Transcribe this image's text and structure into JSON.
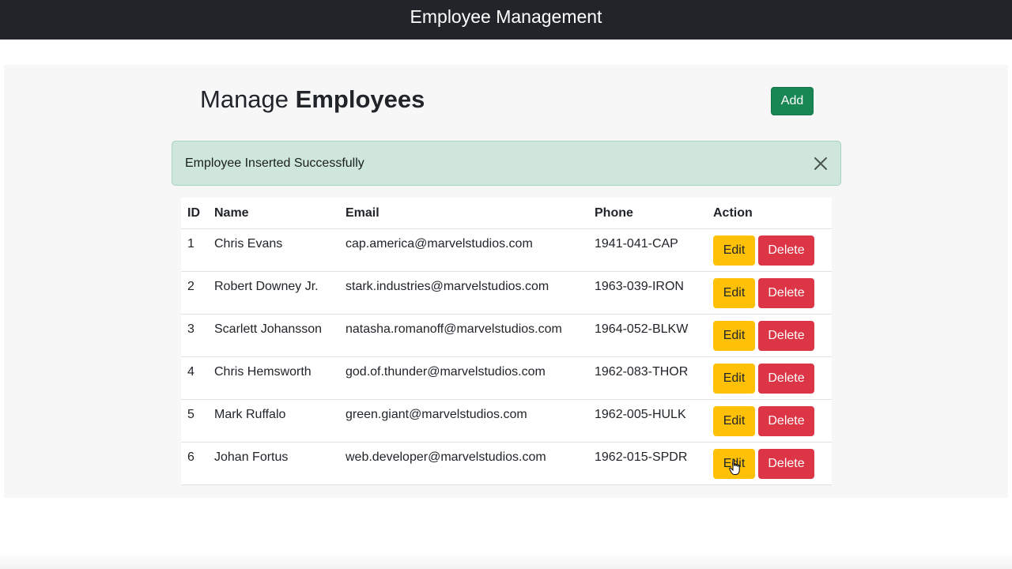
{
  "navbar": {
    "title": "Employee Management"
  },
  "header": {
    "title_prefix": "Manage",
    "title_bold": "Employees",
    "add_label": "Add"
  },
  "alert": {
    "message": "Employee Inserted Successfully",
    "close_icon": "close-icon"
  },
  "table": {
    "columns": [
      "ID",
      "Name",
      "Email",
      "Phone",
      "Action"
    ],
    "rows": [
      {
        "id": "1",
        "name": "Chris Evans",
        "email": "cap.america@marvelstudios.com",
        "phone": "1941-041-CAP"
      },
      {
        "id": "2",
        "name": "Robert Downey Jr.",
        "email": "stark.industries@marvelstudios.com",
        "phone": "1963-039-IRON"
      },
      {
        "id": "3",
        "name": "Scarlett Johansson",
        "email": "natasha.romanoff@marvelstudios.com",
        "phone": "1964-052-BLKW"
      },
      {
        "id": "4",
        "name": "Chris Hemsworth",
        "email": "god.of.thunder@marvelstudios.com",
        "phone": "1962-083-THOR"
      },
      {
        "id": "5",
        "name": "Mark Ruffalo",
        "email": "green.giant@marvelstudios.com",
        "phone": "1962-005-HULK"
      },
      {
        "id": "6",
        "name": "Johan Fortus",
        "email": "web.developer@marvelstudios.com",
        "phone": "1962-015-SPDR"
      }
    ],
    "edit_label": "Edit",
    "delete_label": "Delete"
  },
  "colors": {
    "navbar_bg": "#212529",
    "add_button": "#198754",
    "alert_bg": "#cfe6dc",
    "edit_button": "#ffc107",
    "delete_button": "#dc3545"
  }
}
